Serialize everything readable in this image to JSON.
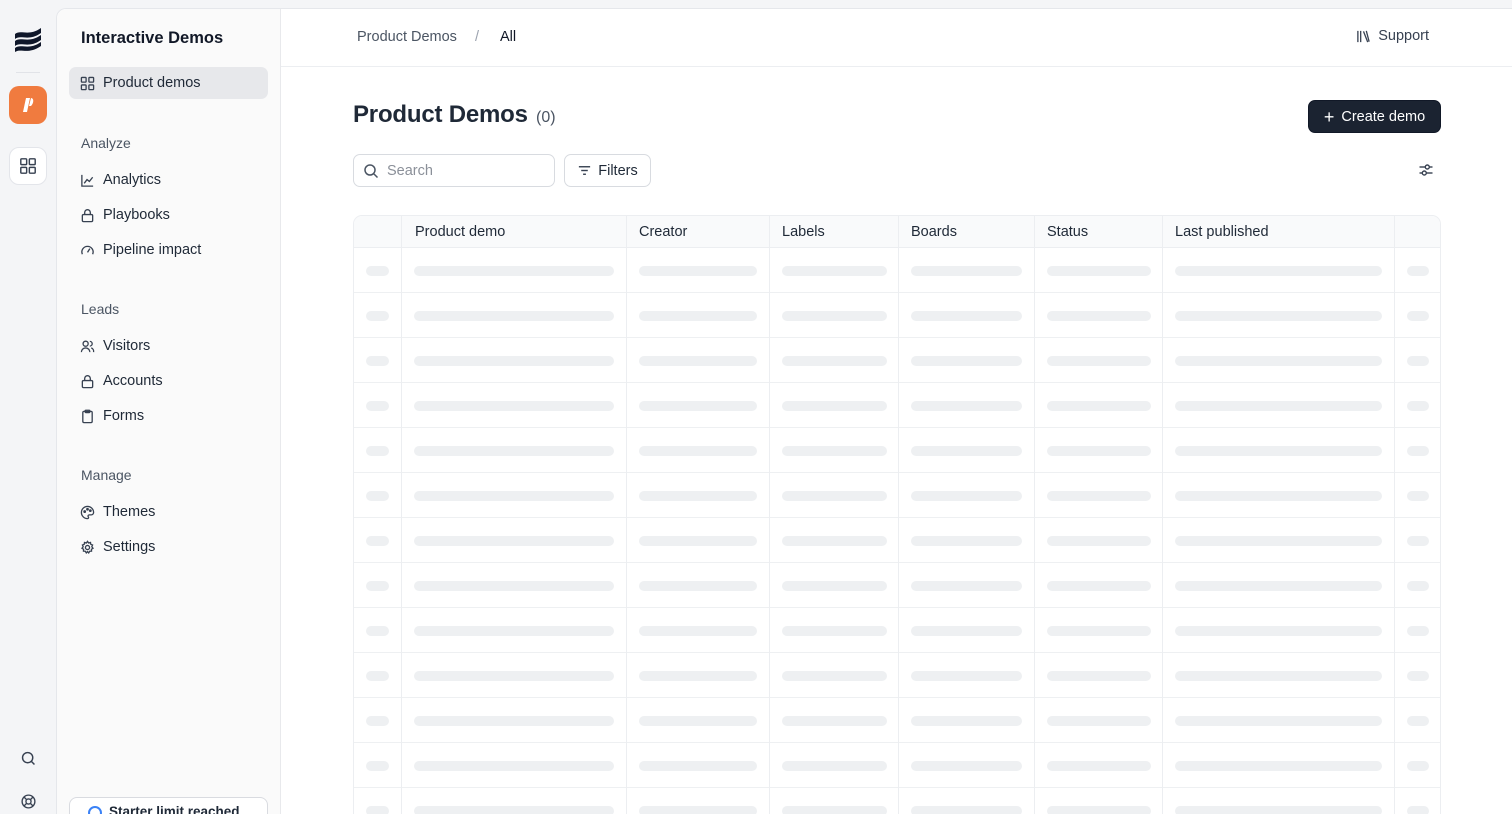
{
  "rail": {
    "logo_icon": "brand-wave-icon",
    "app_icon": "app-logo-icon",
    "grid_icon": "grid-icon",
    "search_icon": "search-icon",
    "help_icon": "help-icon",
    "accent": "#f07b3f"
  },
  "sidebar": {
    "title": "Interactive Demos",
    "items": [
      {
        "label": "Product demos",
        "icon": "grid-icon",
        "active": true
      }
    ],
    "sections": [
      {
        "title": "Analyze",
        "items": [
          {
            "label": "Analytics",
            "icon": "line-chart-icon"
          },
          {
            "label": "Playbooks",
            "icon": "lock-icon"
          },
          {
            "label": "Pipeline impact",
            "icon": "gauge-icon"
          }
        ]
      },
      {
        "title": "Leads",
        "items": [
          {
            "label": "Visitors",
            "icon": "users-icon"
          },
          {
            "label": "Accounts",
            "icon": "lock-icon"
          },
          {
            "label": "Forms",
            "icon": "clipboard-icon"
          }
        ]
      },
      {
        "title": "Manage",
        "items": [
          {
            "label": "Themes",
            "icon": "palette-icon"
          },
          {
            "label": "Settings",
            "icon": "gear-icon"
          }
        ]
      }
    ],
    "limit_label": "Starter limit reached"
  },
  "breadcrumb": {
    "items": [
      "Product Demos",
      "All"
    ],
    "separator": "/"
  },
  "support_label": "Support",
  "page": {
    "title": "Product Demos",
    "count": "(0)",
    "create_label": "Create demo"
  },
  "toolbar": {
    "search_placeholder": "Search",
    "search_value": "",
    "filters_label": "Filters"
  },
  "table": {
    "columns": [
      "Product demo",
      "Creator",
      "Labels",
      "Boards",
      "Status",
      "Last published"
    ],
    "state": "loading"
  }
}
